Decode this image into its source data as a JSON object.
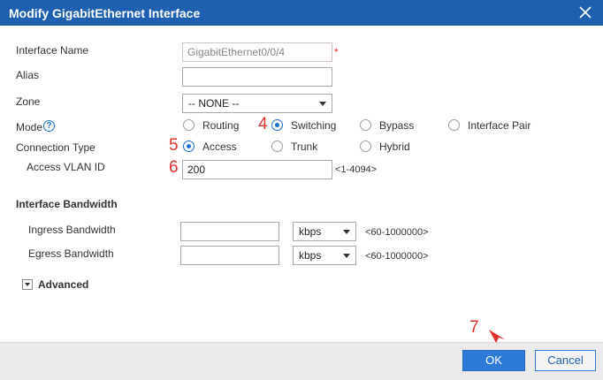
{
  "dialog": {
    "title": "Modify GigabitEthernet Interface"
  },
  "form": {
    "interface_name": {
      "label": "Interface Name",
      "value": "GigabitEthernet0/0/4",
      "required_mark": "*"
    },
    "alias": {
      "label": "Alias",
      "value": ""
    },
    "zone": {
      "label": "Zone",
      "value": "-- NONE --"
    },
    "mode": {
      "label": "Mode",
      "help": "?",
      "options": [
        "Routing",
        "Switching",
        "Bypass",
        "Interface Pair"
      ],
      "selected": "Switching"
    },
    "connection_type": {
      "label": "Connection Type",
      "options": [
        "Access",
        "Trunk",
        "Hybrid"
      ],
      "selected": "Access"
    },
    "access_vlan": {
      "label": "Access VLAN ID",
      "value": "200",
      "range": "<1-4094>"
    },
    "bandwidth": {
      "section_label": "Interface Bandwidth",
      "ingress": {
        "label": "Ingress Bandwidth",
        "value": "",
        "unit": "kbps",
        "range": "<60-1000000>"
      },
      "egress": {
        "label": "Egress Bandwidth",
        "value": "",
        "unit": "kbps",
        "range": "<60-1000000>"
      }
    },
    "advanced": {
      "label": "Advanced"
    }
  },
  "annotations": {
    "step4": "4",
    "step5": "5",
    "step6": "6",
    "step7": "7"
  },
  "buttons": {
    "ok": "OK",
    "cancel": "Cancel"
  },
  "colors": {
    "titlebar": "#1f5fb0",
    "accent": "#2d7ad8",
    "annotation": "#e0312d"
  }
}
